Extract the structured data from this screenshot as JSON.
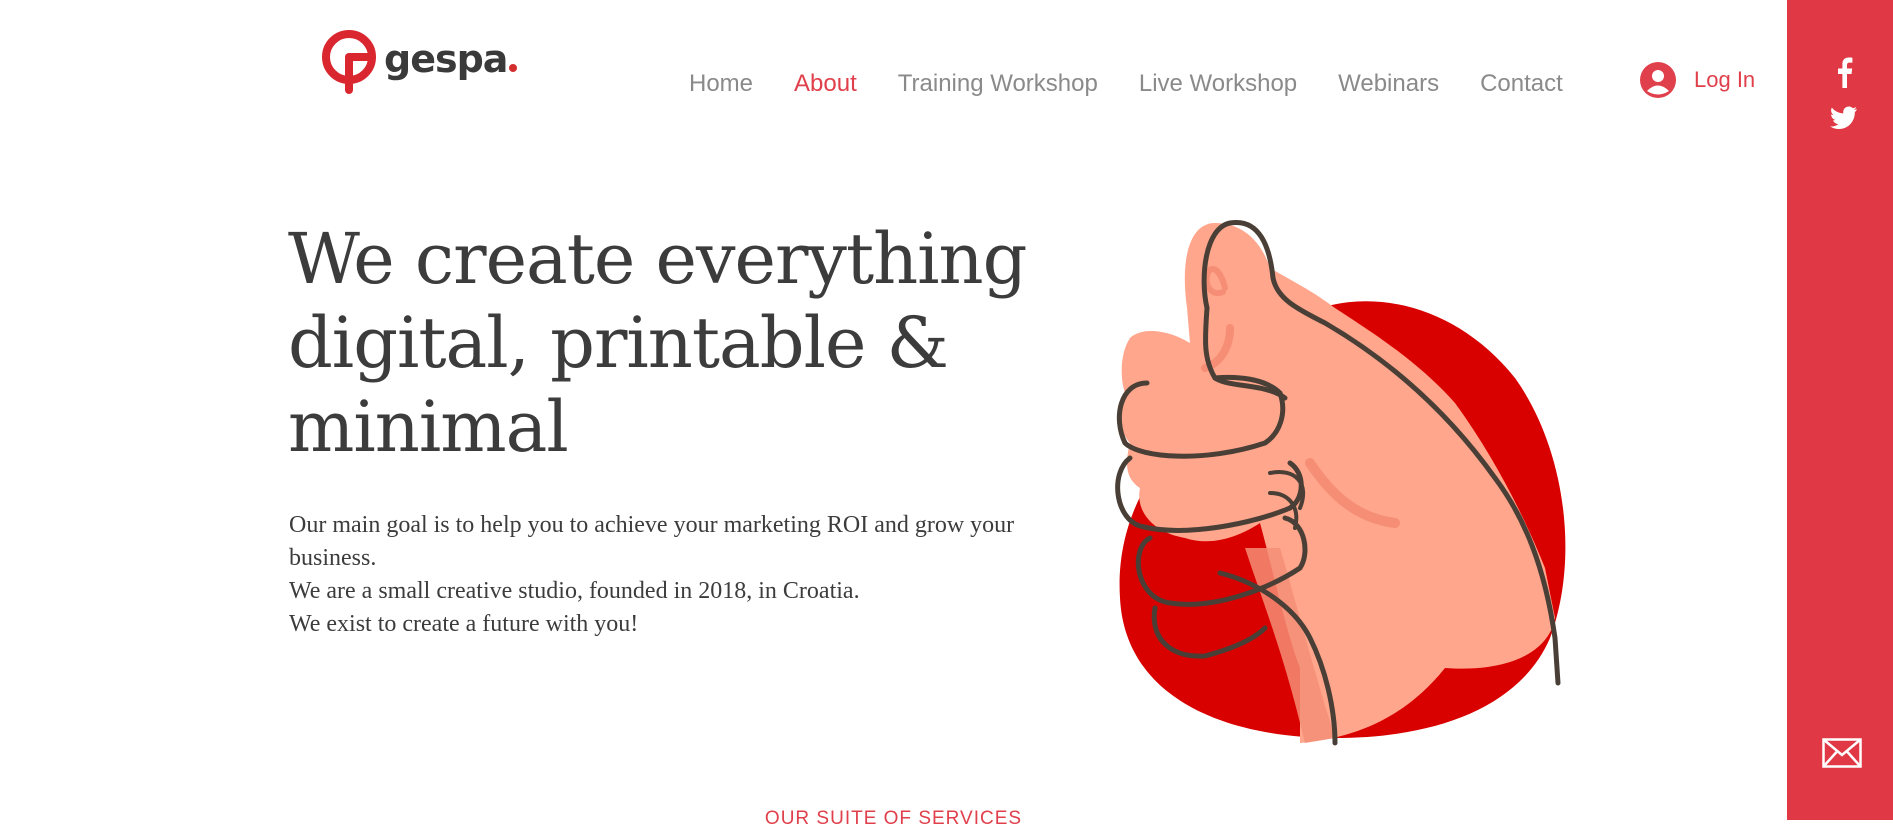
{
  "brand": {
    "name": "gespa",
    "accent_color": "#e0404b",
    "sidebar_color": "#e03844"
  },
  "nav": {
    "items": [
      {
        "label": "Home",
        "active": false
      },
      {
        "label": "About",
        "active": true
      },
      {
        "label": "Training Workshop",
        "active": false
      },
      {
        "label": "Live Workshop",
        "active": false
      },
      {
        "label": "Webinars",
        "active": false
      },
      {
        "label": "Contact",
        "active": false
      }
    ]
  },
  "login": {
    "label": "Log In",
    "icon": "user-avatar-icon"
  },
  "social": {
    "items": [
      {
        "icon": "facebook-icon"
      },
      {
        "icon": "twitter-icon"
      }
    ],
    "mail_icon": "mail-icon"
  },
  "hero": {
    "headline_lines": [
      "We create everything",
      "digital, printable &",
      "minimal"
    ],
    "paragraphs": [
      "Our main goal is to help you to achieve your marketing ROI and grow your business.",
      "We are a small creative studio, founded in 2018, in Croatia.",
      "We exist to create a future with you!"
    ]
  },
  "services": {
    "title": "OUR SUITE OF SERVICES"
  }
}
